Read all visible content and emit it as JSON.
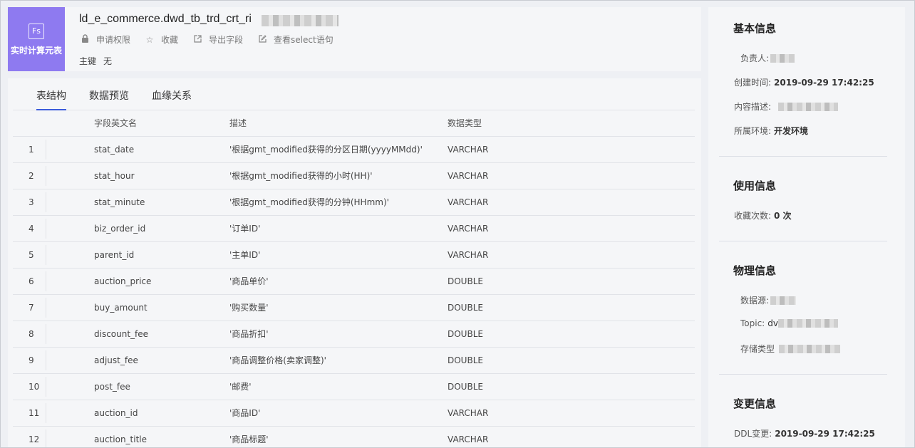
{
  "header": {
    "badge_icon": "Fs",
    "badge_label": "实时计算元表",
    "table_name": "ld_e_commerce.dwd_tb_trd_crt_ri",
    "actions": [
      {
        "icon": "lock-icon",
        "label": "申请权限"
      },
      {
        "icon": "star-icon",
        "label": "收藏"
      },
      {
        "icon": "export-icon",
        "label": "导出字段"
      },
      {
        "icon": "edit-icon",
        "label": "查看select语句"
      }
    ],
    "primary_key_label": "主键",
    "primary_key_value": "无"
  },
  "tabs": [
    "表结构",
    "数据预览",
    "血缘关系"
  ],
  "table": {
    "columns": [
      "字段英文名",
      "描述",
      "数据类型"
    ],
    "rows": [
      {
        "idx": "1",
        "name": "stat_date",
        "desc": "'根据gmt_modified获得的分区日期(yyyyMMdd)'",
        "type": "VARCHAR"
      },
      {
        "idx": "2",
        "name": "stat_hour",
        "desc": "'根据gmt_modified获得的小时(HH)'",
        "type": "VARCHAR"
      },
      {
        "idx": "3",
        "name": "stat_minute",
        "desc": "'根据gmt_modified获得的分钟(HHmm)'",
        "type": "VARCHAR"
      },
      {
        "idx": "4",
        "name": "biz_order_id",
        "desc": "'订单ID'",
        "type": "VARCHAR"
      },
      {
        "idx": "5",
        "name": "parent_id",
        "desc": "'主单ID'",
        "type": "VARCHAR"
      },
      {
        "idx": "6",
        "name": "auction_price",
        "desc": "'商品单价'",
        "type": "DOUBLE"
      },
      {
        "idx": "7",
        "name": "buy_amount",
        "desc": "'购买数量'",
        "type": "DOUBLE"
      },
      {
        "idx": "8",
        "name": "discount_fee",
        "desc": "'商品折扣'",
        "type": "DOUBLE"
      },
      {
        "idx": "9",
        "name": "adjust_fee",
        "desc": "'商品调整价格(卖家调整)'",
        "type": "DOUBLE"
      },
      {
        "idx": "10",
        "name": "post_fee",
        "desc": "'邮费'",
        "type": "DOUBLE"
      },
      {
        "idx": "11",
        "name": "auction_id",
        "desc": "'商品ID'",
        "type": "VARCHAR"
      },
      {
        "idx": "12",
        "name": "auction_title",
        "desc": "'商品标题'",
        "type": "VARCHAR"
      }
    ]
  },
  "side": {
    "basic": {
      "title": "基本信息",
      "owner_label": "负责人:",
      "created_label": "创建时间:",
      "created_value": "2019-09-29 17:42:25",
      "desc_label": "内容描述:",
      "env_label": "所属环境:",
      "env_value": "开发环境"
    },
    "usage": {
      "title": "使用信息",
      "fav_label": "收藏次数:",
      "fav_value": "0 次"
    },
    "physical": {
      "title": "物理信息",
      "source_label": "数据源:",
      "topic_label": "Topic:",
      "topic_value": "dv",
      "storage_label": "存储类型"
    },
    "change": {
      "title": "变更信息",
      "ddl_label": "DDL变更:",
      "ddl_value": "2019-09-29 17:42:25"
    }
  },
  "colors": {
    "badge": "#8e7af0",
    "tab_active": "#3b5bdb"
  }
}
